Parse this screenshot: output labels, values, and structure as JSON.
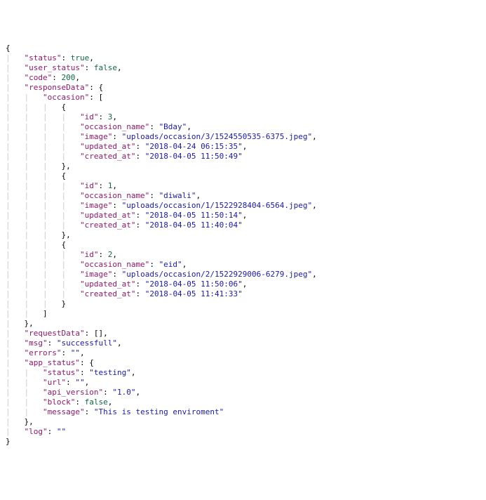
{
  "raw": {
    "status": true,
    "user_status": false,
    "code": 200,
    "responseData": {
      "occasion": [
        {
          "id": 3,
          "occasion_name": "Bday",
          "image": "uploads/occasion/3/1524550535-6375.jpeg",
          "updated_at": "2018-04-24 06:15:35",
          "created_at": "2018-04-05 11:50:49"
        },
        {
          "id": 1,
          "occasion_name": "diwali",
          "image": "uploads/occasion/1/1522928404-6564.jpeg",
          "updated_at": "2018-04-05 11:50:14",
          "created_at": "2018-04-05 11:40:04"
        },
        {
          "id": 2,
          "occasion_name": "eid",
          "image": "uploads/occasion/2/1522929006-6279.jpeg",
          "updated_at": "2018-04-05 11:50:06",
          "created_at": "2018-04-05 11:41:33"
        }
      ]
    },
    "requestData": [],
    "msg": "successfull",
    "errors": "",
    "app_status": {
      "status": "testing",
      "url": "",
      "api_version": "1.0",
      "block": false,
      "message": "This is testing enviroment"
    },
    "log": ""
  },
  "lines": [
    {
      "guides": 0,
      "tokens": [
        {
          "t": "punc",
          "v": "{"
        }
      ]
    },
    {
      "guides": 1,
      "tokens": [
        {
          "t": "key",
          "v": "\"status\""
        },
        {
          "t": "punc",
          "v": ": "
        },
        {
          "t": "bool",
          "v": "true"
        },
        {
          "t": "punc",
          "v": ","
        }
      ]
    },
    {
      "guides": 1,
      "tokens": [
        {
          "t": "key",
          "v": "\"user_status\""
        },
        {
          "t": "punc",
          "v": ": "
        },
        {
          "t": "bool",
          "v": "false"
        },
        {
          "t": "punc",
          "v": ","
        }
      ]
    },
    {
      "guides": 1,
      "tokens": [
        {
          "t": "key",
          "v": "\"code\""
        },
        {
          "t": "punc",
          "v": ": "
        },
        {
          "t": "num",
          "v": "200"
        },
        {
          "t": "punc",
          "v": ","
        }
      ]
    },
    {
      "guides": 1,
      "tokens": [
        {
          "t": "key",
          "v": "\"responseData\""
        },
        {
          "t": "punc",
          "v": ": {"
        }
      ]
    },
    {
      "guides": 2,
      "tokens": [
        {
          "t": "key",
          "v": "\"occasion\""
        },
        {
          "t": "punc",
          "v": ": ["
        }
      ]
    },
    {
      "guides": 3,
      "tokens": [
        {
          "t": "punc",
          "v": "{"
        }
      ]
    },
    {
      "guides": 4,
      "tokens": [
        {
          "t": "key",
          "v": "\"id\""
        },
        {
          "t": "punc",
          "v": ": "
        },
        {
          "t": "num",
          "v": "3"
        },
        {
          "t": "punc",
          "v": ","
        }
      ]
    },
    {
      "guides": 4,
      "tokens": [
        {
          "t": "key",
          "v": "\"occasion_name\""
        },
        {
          "t": "punc",
          "v": ": "
        },
        {
          "t": "str",
          "v": "\"Bday\""
        },
        {
          "t": "punc",
          "v": ","
        }
      ]
    },
    {
      "guides": 4,
      "tokens": [
        {
          "t": "key",
          "v": "\"image\""
        },
        {
          "t": "punc",
          "v": ": "
        },
        {
          "t": "str",
          "v": "\"uploads/occasion/3/1524550535-6375.jpeg\""
        },
        {
          "t": "punc",
          "v": ","
        }
      ]
    },
    {
      "guides": 4,
      "tokens": [
        {
          "t": "key",
          "v": "\"updated_at\""
        },
        {
          "t": "punc",
          "v": ": "
        },
        {
          "t": "str",
          "v": "\"2018-04-24 06:15:35\""
        },
        {
          "t": "punc",
          "v": ","
        }
      ]
    },
    {
      "guides": 4,
      "tokens": [
        {
          "t": "key",
          "v": "\"created_at\""
        },
        {
          "t": "punc",
          "v": ": "
        },
        {
          "t": "str",
          "v": "\"2018-04-05 11:50:49\""
        }
      ]
    },
    {
      "guides": 3,
      "tokens": [
        {
          "t": "punc",
          "v": "},"
        }
      ]
    },
    {
      "guides": 3,
      "tokens": [
        {
          "t": "punc",
          "v": "{"
        }
      ]
    },
    {
      "guides": 4,
      "tokens": [
        {
          "t": "key",
          "v": "\"id\""
        },
        {
          "t": "punc",
          "v": ": "
        },
        {
          "t": "num",
          "v": "1"
        },
        {
          "t": "punc",
          "v": ","
        }
      ]
    },
    {
      "guides": 4,
      "tokens": [
        {
          "t": "key",
          "v": "\"occasion_name\""
        },
        {
          "t": "punc",
          "v": ": "
        },
        {
          "t": "str",
          "v": "\"diwali\""
        },
        {
          "t": "punc",
          "v": ","
        }
      ]
    },
    {
      "guides": 4,
      "tokens": [
        {
          "t": "key",
          "v": "\"image\""
        },
        {
          "t": "punc",
          "v": ": "
        },
        {
          "t": "str",
          "v": "\"uploads/occasion/1/1522928404-6564.jpeg\""
        },
        {
          "t": "punc",
          "v": ","
        }
      ]
    },
    {
      "guides": 4,
      "tokens": [
        {
          "t": "key",
          "v": "\"updated_at\""
        },
        {
          "t": "punc",
          "v": ": "
        },
        {
          "t": "str",
          "v": "\"2018-04-05 11:50:14\""
        },
        {
          "t": "punc",
          "v": ","
        }
      ]
    },
    {
      "guides": 4,
      "tokens": [
        {
          "t": "key",
          "v": "\"created_at\""
        },
        {
          "t": "punc",
          "v": ": "
        },
        {
          "t": "str",
          "v": "\"2018-04-05 11:40:04\""
        }
      ]
    },
    {
      "guides": 3,
      "tokens": [
        {
          "t": "punc",
          "v": "},"
        }
      ]
    },
    {
      "guides": 3,
      "tokens": [
        {
          "t": "punc",
          "v": "{"
        }
      ]
    },
    {
      "guides": 4,
      "tokens": [
        {
          "t": "key",
          "v": "\"id\""
        },
        {
          "t": "punc",
          "v": ": "
        },
        {
          "t": "num",
          "v": "2"
        },
        {
          "t": "punc",
          "v": ","
        }
      ]
    },
    {
      "guides": 4,
      "tokens": [
        {
          "t": "key",
          "v": "\"occasion_name\""
        },
        {
          "t": "punc",
          "v": ": "
        },
        {
          "t": "str",
          "v": "\"eid\""
        },
        {
          "t": "punc",
          "v": ","
        }
      ]
    },
    {
      "guides": 4,
      "tokens": [
        {
          "t": "key",
          "v": "\"image\""
        },
        {
          "t": "punc",
          "v": ": "
        },
        {
          "t": "str",
          "v": "\"uploads/occasion/2/1522929006-6279.jpeg\""
        },
        {
          "t": "punc",
          "v": ","
        }
      ]
    },
    {
      "guides": 4,
      "tokens": [
        {
          "t": "key",
          "v": "\"updated_at\""
        },
        {
          "t": "punc",
          "v": ": "
        },
        {
          "t": "str",
          "v": "\"2018-04-05 11:50:06\""
        },
        {
          "t": "punc",
          "v": ","
        }
      ]
    },
    {
      "guides": 4,
      "tokens": [
        {
          "t": "key",
          "v": "\"created_at\""
        },
        {
          "t": "punc",
          "v": ": "
        },
        {
          "t": "str",
          "v": "\"2018-04-05 11:41:33\""
        }
      ]
    },
    {
      "guides": 3,
      "tokens": [
        {
          "t": "punc",
          "v": "}"
        }
      ]
    },
    {
      "guides": 2,
      "tokens": [
        {
          "t": "punc",
          "v": "]"
        }
      ]
    },
    {
      "guides": 1,
      "tokens": [
        {
          "t": "punc",
          "v": "},"
        }
      ]
    },
    {
      "guides": 1,
      "tokens": [
        {
          "t": "key",
          "v": "\"requestData\""
        },
        {
          "t": "punc",
          "v": ": [],"
        }
      ]
    },
    {
      "guides": 1,
      "tokens": [
        {
          "t": "key",
          "v": "\"msg\""
        },
        {
          "t": "punc",
          "v": ": "
        },
        {
          "t": "str",
          "v": "\"successfull\""
        },
        {
          "t": "punc",
          "v": ","
        }
      ]
    },
    {
      "guides": 1,
      "tokens": [
        {
          "t": "key",
          "v": "\"errors\""
        },
        {
          "t": "punc",
          "v": ": "
        },
        {
          "t": "str",
          "v": "\"\""
        },
        {
          "t": "punc",
          "v": ","
        }
      ]
    },
    {
      "guides": 1,
      "tokens": [
        {
          "t": "key",
          "v": "\"app_status\""
        },
        {
          "t": "punc",
          "v": ": {"
        }
      ]
    },
    {
      "guides": 2,
      "tokens": [
        {
          "t": "key",
          "v": "\"status\""
        },
        {
          "t": "punc",
          "v": ": "
        },
        {
          "t": "str",
          "v": "\"testing\""
        },
        {
          "t": "punc",
          "v": ","
        }
      ]
    },
    {
      "guides": 2,
      "tokens": [
        {
          "t": "key",
          "v": "\"url\""
        },
        {
          "t": "punc",
          "v": ": "
        },
        {
          "t": "str",
          "v": "\"\""
        },
        {
          "t": "punc",
          "v": ","
        }
      ]
    },
    {
      "guides": 2,
      "tokens": [
        {
          "t": "key",
          "v": "\"api_version\""
        },
        {
          "t": "punc",
          "v": ": "
        },
        {
          "t": "str",
          "v": "\"1.0\""
        },
        {
          "t": "punc",
          "v": ","
        }
      ]
    },
    {
      "guides": 2,
      "tokens": [
        {
          "t": "key",
          "v": "\"block\""
        },
        {
          "t": "punc",
          "v": ": "
        },
        {
          "t": "bool",
          "v": "false"
        },
        {
          "t": "punc",
          "v": ","
        }
      ]
    },
    {
      "guides": 2,
      "tokens": [
        {
          "t": "key",
          "v": "\"message\""
        },
        {
          "t": "punc",
          "v": ": "
        },
        {
          "t": "str",
          "v": "\"This is testing enviroment\""
        }
      ]
    },
    {
      "guides": 1,
      "tokens": [
        {
          "t": "punc",
          "v": "},"
        }
      ]
    },
    {
      "guides": 1,
      "tokens": [
        {
          "t": "key",
          "v": "\"log\""
        },
        {
          "t": "punc",
          "v": ": "
        },
        {
          "t": "str",
          "v": "\"\""
        }
      ]
    },
    {
      "guides": 0,
      "tokens": [
        {
          "t": "punc",
          "v": "}"
        }
      ]
    }
  ]
}
